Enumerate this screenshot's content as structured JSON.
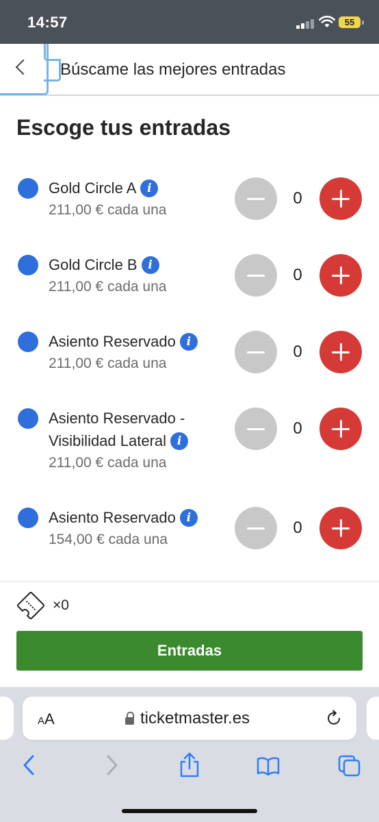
{
  "status_bar": {
    "time": "14:57",
    "battery": "55"
  },
  "header": {
    "title": "Búscame las mejores entradas"
  },
  "main": {
    "heading": "Escoge tus entradas",
    "tickets": [
      {
        "name": "Gold Circle A",
        "name_line2": "",
        "price": "211,00 € cada una",
        "quantity": "0"
      },
      {
        "name": "Gold Circle B",
        "name_line2": "",
        "price": "211,00 € cada una",
        "quantity": "0"
      },
      {
        "name": "Asiento Reservado",
        "name_line2": "",
        "price": "211,00 € cada una",
        "quantity": "0"
      },
      {
        "name": "Asiento Reservado -",
        "name_line2": "Visibilidad Lateral",
        "price": "211,00 € cada una",
        "quantity": "0"
      },
      {
        "name": "Asiento Reservado",
        "name_line2": "",
        "price": "154,00 € cada una",
        "quantity": "0"
      }
    ],
    "info_glyph": "i"
  },
  "footer": {
    "ticket_count": "×0",
    "cta_label": "Entradas"
  },
  "browser": {
    "aa_label_small": "A",
    "aa_label_large": "A",
    "url": "ticketmaster.es"
  },
  "colors": {
    "accent_blue": "#2e6fdc",
    "plus_red": "#d53a36",
    "cta_green": "#3b8a2d",
    "minus_grey": "#c8c8c8"
  }
}
